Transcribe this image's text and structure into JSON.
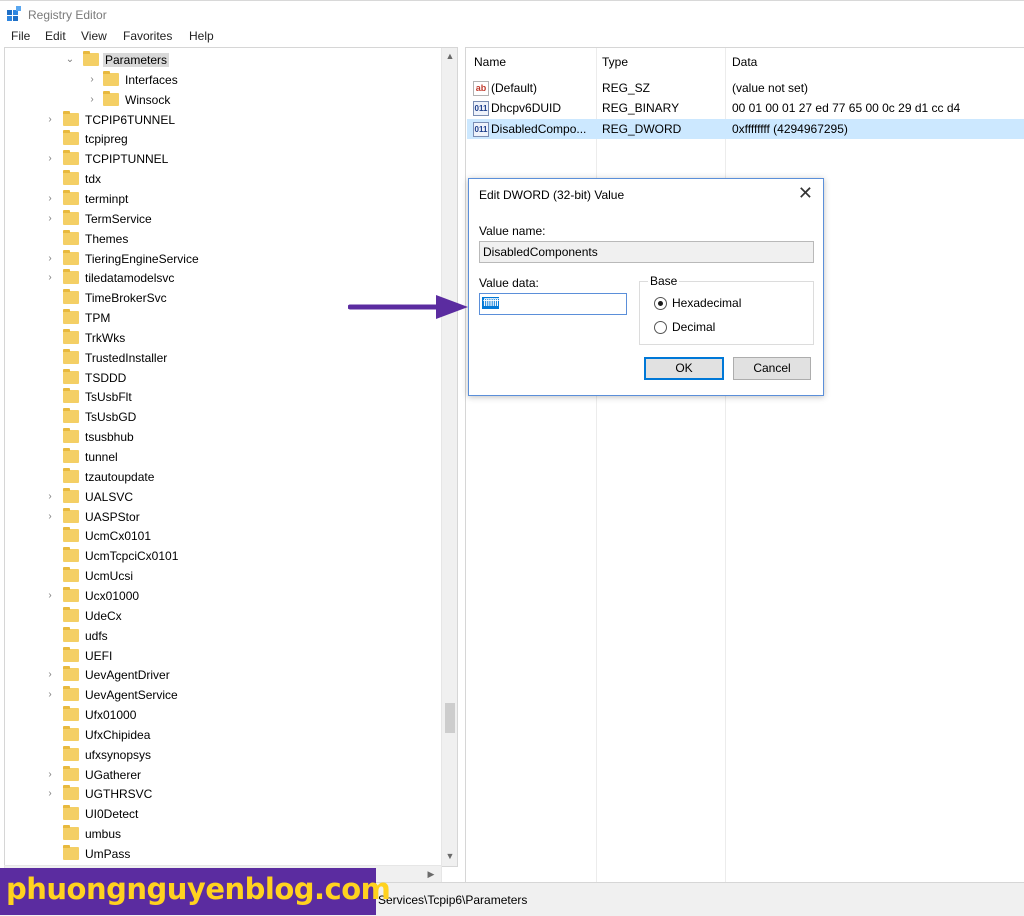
{
  "window": {
    "title": "Registry Editor"
  },
  "menu": [
    "File",
    "Edit",
    "View",
    "Favorites",
    "Help"
  ],
  "tree": {
    "items": [
      {
        "label": "Parameters",
        "expanded": true,
        "selected": true
      },
      {
        "label": "Interfaces"
      },
      {
        "label": "Winsock"
      },
      {
        "label": "TCPIP6TUNNEL"
      },
      {
        "label": "tcpipreg"
      },
      {
        "label": "TCPIPTUNNEL"
      },
      {
        "label": "tdx"
      },
      {
        "label": "terminpt"
      },
      {
        "label": "TermService"
      },
      {
        "label": "Themes"
      },
      {
        "label": "TieringEngineService"
      },
      {
        "label": "tiledatamodelsvc"
      },
      {
        "label": "TimeBrokerSvc"
      },
      {
        "label": "TPM"
      },
      {
        "label": "TrkWks"
      },
      {
        "label": "TrustedInstaller"
      },
      {
        "label": "TSDDD"
      },
      {
        "label": "TsUsbFlt"
      },
      {
        "label": "TsUsbGD"
      },
      {
        "label": "tsusbhub"
      },
      {
        "label": "tunnel"
      },
      {
        "label": "tzautoupdate"
      },
      {
        "label": "UALSVC"
      },
      {
        "label": "UASPStor"
      },
      {
        "label": "UcmCx0101"
      },
      {
        "label": "UcmTcpciCx0101"
      },
      {
        "label": "UcmUcsi"
      },
      {
        "label": "Ucx01000"
      },
      {
        "label": "UdeCx"
      },
      {
        "label": "udfs"
      },
      {
        "label": "UEFI"
      },
      {
        "label": "UevAgentDriver"
      },
      {
        "label": "UevAgentService"
      },
      {
        "label": "Ufx01000"
      },
      {
        "label": "UfxChipidea"
      },
      {
        "label": "ufxsynopsys"
      },
      {
        "label": "UGatherer"
      },
      {
        "label": "UGTHRSVC"
      },
      {
        "label": "UI0Detect"
      },
      {
        "label": "umbus"
      },
      {
        "label": "UmPass"
      }
    ]
  },
  "values": {
    "headers": {
      "name": "Name",
      "type": "Type",
      "data": "Data"
    },
    "rows": [
      {
        "icon": "ab",
        "name": "(Default)",
        "type": "REG_SZ",
        "data": "(value not set)"
      },
      {
        "icon": "011",
        "name": "Dhcpv6DUID",
        "type": "REG_BINARY",
        "data": "00 01 00 01 27 ed 77 65 00 0c 29 d1 cc d4"
      },
      {
        "icon": "011",
        "name": "DisabledCompo...",
        "type": "REG_DWORD",
        "data": "0xffffffff (4294967295)",
        "selected": true
      }
    ]
  },
  "dialog": {
    "title": "Edit DWORD (32-bit) Value",
    "close_glyph": "✕",
    "value_name_label": "Value name:",
    "value_name": "DisabledComponents",
    "value_data_label": "Value data:",
    "value_data": "ffffffff",
    "base_label": "Base",
    "base_options": [
      {
        "label": "Hexadecimal",
        "checked": true
      },
      {
        "label": "Decimal",
        "checked": false
      }
    ],
    "ok_label": "OK",
    "cancel_label": "Cancel"
  },
  "statusbar": {
    "path": "Services\\Tcpip6\\Parameters"
  },
  "watermark": {
    "text": "phuongnguyenblog.com"
  },
  "colors": {
    "selection": "#cce8ff",
    "accent": "#0078d7",
    "arrow": "#5b2ca0",
    "watermark_text": "#ffd21f"
  },
  "icons": {
    "left_scroll": "chevron-left-icon",
    "right_scroll": "chevron-right-icon",
    "up_scroll": "chevron-up-icon",
    "down_scroll": "chevron-down-icon"
  }
}
